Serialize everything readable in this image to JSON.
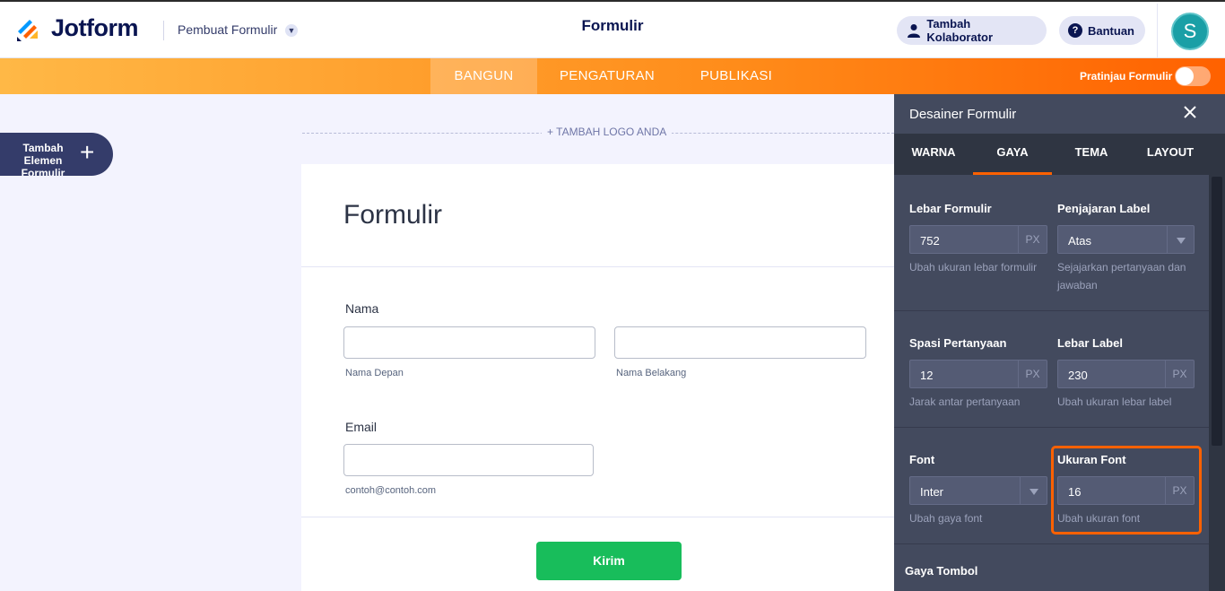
{
  "header": {
    "brand": "Jotform",
    "builder_menu": "Pembuat Formulir",
    "title": "Formulir",
    "collaborator_button": "Tambah Kolaborator",
    "help_button": "Bantuan",
    "avatar_initial": "S"
  },
  "nav": {
    "tabs": [
      "BANGUN",
      "PENGATURAN",
      "PUBLIKASI"
    ],
    "active_tab": "BANGUN",
    "preview_label": "Pratinjau Formulir",
    "preview_enabled": false
  },
  "left": {
    "add_element": "Tambah Elemen Formulir"
  },
  "form": {
    "add_logo": "+ TAMBAH LOGO ANDA",
    "title": "Formulir",
    "name_label": "Nama",
    "first_name_sub": "Nama Depan",
    "last_name_sub": "Nama Belakang",
    "email_label": "Email",
    "email_sub": "contoh@contoh.com",
    "submit": "Kirim"
  },
  "designer": {
    "title": "Desainer Formulir",
    "tabs": [
      "WARNA",
      "GAYA",
      "TEMA",
      "LAYOUT"
    ],
    "active_tab": "GAYA",
    "form_width": {
      "label": "Lebar Formulir",
      "value": "752",
      "unit": "PX",
      "hint": "Ubah ukuran lebar formulir"
    },
    "label_alignment": {
      "label": "Penjajaran Label",
      "value": "Atas",
      "hint": "Sejajarkan pertanyaan dan jawaban"
    },
    "question_spacing": {
      "label": "Spasi Pertanyaan",
      "value": "12",
      "unit": "PX",
      "hint": "Jarak antar pertanyaan"
    },
    "label_width": {
      "label": "Lebar Label",
      "value": "230",
      "unit": "PX",
      "hint": "Ubah ukuran lebar label"
    },
    "font": {
      "label": "Font",
      "value": "Inter",
      "hint": "Ubah gaya font"
    },
    "font_size": {
      "label": "Ukuran Font",
      "value": "16",
      "unit": "PX",
      "hint": "Ubah ukuran font"
    },
    "button_style": {
      "label": "Gaya Tombol"
    }
  },
  "colors": {
    "accent": "#ff6100",
    "submit": "#18bd5b",
    "panel": "#434a5e",
    "avatar": "#1a9fa6"
  }
}
